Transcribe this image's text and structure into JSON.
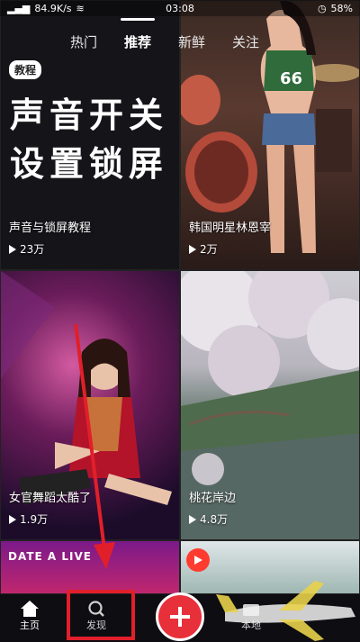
{
  "status_bar": {
    "speed": "84.9K/s",
    "time": "03:08",
    "battery": "58%"
  },
  "top_tabs": [
    {
      "label": "热门"
    },
    {
      "label": "推荐"
    },
    {
      "label": "新鲜"
    },
    {
      "label": "关注"
    }
  ],
  "cards": [
    {
      "badge": "教程",
      "big_line1": "声音开关",
      "big_line2": "设置锁屏",
      "title": "声音与锁屏教程",
      "views": "23万"
    },
    {
      "title": "韩国明星林恩宰",
      "views": "2万"
    },
    {
      "title": "女官舞蹈太酷了",
      "views": "1.9万"
    },
    {
      "title": "桃花岸边",
      "views": "4.8万"
    },
    {
      "caption": "DATE A LIVE"
    }
  ],
  "bottom_nav": {
    "home_label": "主页",
    "discover_label": "发现",
    "local_label": "本地"
  },
  "colors": {
    "accent_red": "#e8303b",
    "highlight_red": "#e11f2a"
  },
  "icons": {
    "home": "home-icon",
    "search": "search-icon",
    "add": "plus-icon",
    "play": "play-icon"
  }
}
